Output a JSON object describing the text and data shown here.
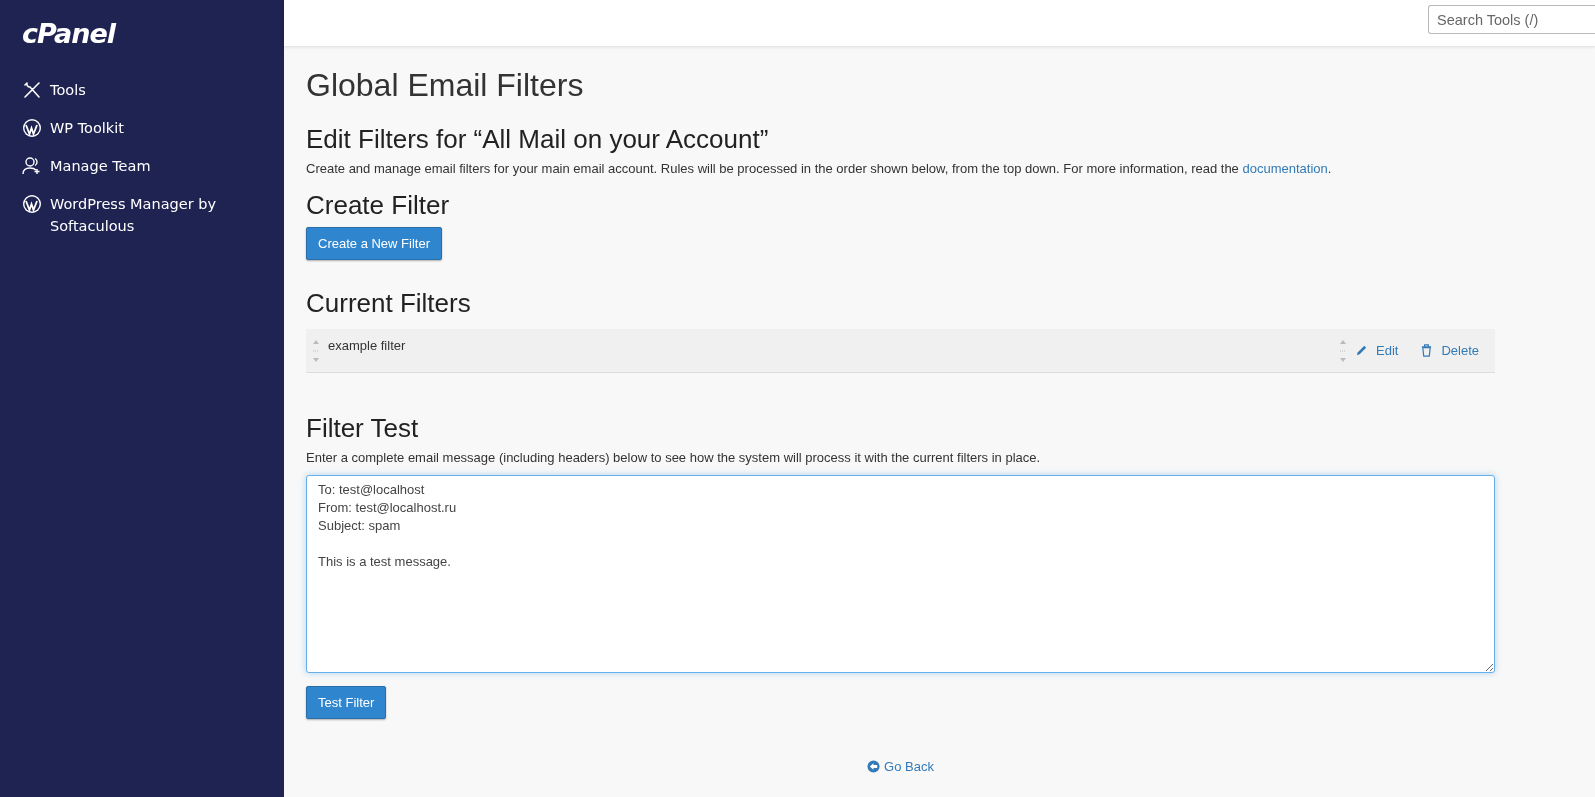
{
  "sidebar": {
    "logo": "cPanel",
    "items": [
      {
        "label": "Tools",
        "kind": "tools"
      },
      {
        "label": "WP Toolkit",
        "kind": "wordpress"
      },
      {
        "label": "Manage Team",
        "kind": "team"
      },
      {
        "label": "WordPress Manager by Softaculous",
        "kind": "wordpress"
      }
    ]
  },
  "topbar": {
    "search": {
      "placeholder": "Search Tools (/)"
    }
  },
  "page_title": "Global Email Filters",
  "edit_heading": "Edit Filters for “All Mail on your Account”",
  "description": {
    "text": "Create and manage email filters for your main email account. Rules will be processed in the order shown below, from the top down. For more information, read the ",
    "link": "documentation",
    "after": "."
  },
  "create_heading": "Create Filter",
  "create_button": "Create a New Filter",
  "current_heading": "Current Filters",
  "filters": [
    {
      "name": "example filter",
      "edit": "Edit",
      "delete": "Delete"
    }
  ],
  "test_heading": "Filter Test",
  "test_description": "Enter a complete email message (including headers) below to see how the system will process it with the current filters in place.",
  "test_message": "To: test@localhost\nFrom: test@localhost.ru\nSubject: spam\n\nThis is a test message.",
  "test_button": "Test Filter",
  "go_back": "Go Back"
}
